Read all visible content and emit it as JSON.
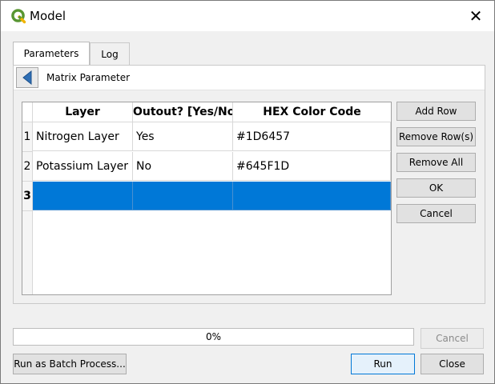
{
  "window": {
    "title": "Model"
  },
  "tabs": [
    {
      "label": "Parameters",
      "active": true
    },
    {
      "label": "Log",
      "active": false
    }
  ],
  "breadcrumb": {
    "label": "Matrix Parameter"
  },
  "table": {
    "columns": [
      "Layer",
      "Outout? [Yes/No",
      "HEX Color Code"
    ],
    "rows": [
      {
        "num": "1",
        "cells": [
          "Nitrogen Layer",
          "Yes",
          "#1D6457"
        ]
      },
      {
        "num": "2",
        "cells": [
          "Potassium Layer",
          "No",
          "#645F1D"
        ]
      },
      {
        "num": "3",
        "cells": [
          "",
          "",
          ""
        ],
        "selected": true
      }
    ]
  },
  "side_buttons": {
    "add_row": "Add Row",
    "remove_rows": "Remove Row(s)",
    "remove_all": "Remove All",
    "ok": "OK",
    "cancel": "Cancel"
  },
  "progress": {
    "value": 0,
    "label": "0%"
  },
  "footer": {
    "cancel": "Cancel",
    "batch": "Run as Batch Process...",
    "run": "Run",
    "close": "Close"
  },
  "colors": {
    "selection": "#0078d7",
    "focus_border": "#0078d7",
    "qgis_green": "#589632"
  }
}
